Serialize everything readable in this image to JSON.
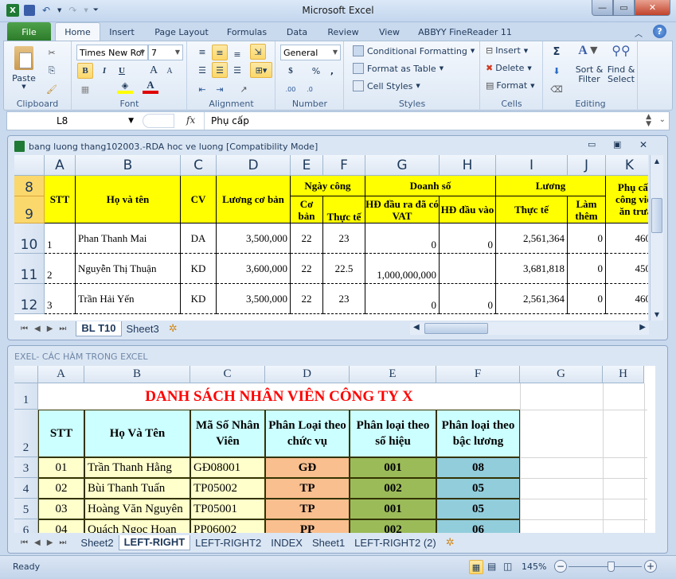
{
  "app": {
    "title": "Microsoft Excel",
    "window_controls": {
      "minimize": "—",
      "maximize": "▭",
      "close": "✕"
    }
  },
  "quick_access": {
    "icons": [
      "excel-logo-icon",
      "save-icon",
      "undo-icon",
      "redo-icon",
      "customize-qat-icon"
    ]
  },
  "ribbon_tabs": [
    "File",
    "Home",
    "Insert",
    "Page Layout",
    "Formulas",
    "Data",
    "Review",
    "View",
    "ABBYY FineReader 11"
  ],
  "active_tab": "Home",
  "ribbon": {
    "clipboard": {
      "label": "Clipboard",
      "paste": "Paste"
    },
    "font": {
      "label": "Font",
      "font_name": "Times New Roi",
      "font_size": "7",
      "bold": "B",
      "italic": "I",
      "underline": "U",
      "grow": "A",
      "shrink": "A",
      "font_color_letter": "A",
      "highlight_color": "#ffff00",
      "font_color": "#e00000"
    },
    "alignment": {
      "label": "Alignment"
    },
    "number": {
      "label": "Number",
      "format": "General",
      "currency": "$",
      "percent": "%",
      "comma": ","
    },
    "styles": {
      "label": "Styles",
      "conditional_formatting": "Conditional Formatting",
      "format_as_table": "Format as Table",
      "cell_styles": "Cell Styles"
    },
    "cells": {
      "label": "Cells",
      "insert": "Insert",
      "delete": "Delete",
      "format": "Format"
    },
    "editing": {
      "label": "Editing",
      "autosum": "Σ",
      "sort_filter_1": "Sort &",
      "sort_filter_2": "Filter",
      "find_select_1": "Find &",
      "find_select_2": "Select"
    }
  },
  "formula_bar": {
    "name_box": "L8",
    "fx": "fx",
    "content": "Phụ cấp"
  },
  "workbook1": {
    "title": "bang luong thang102003.-RDA hoc ve luong  [Compatibility Mode]",
    "columns": [
      "A",
      "B",
      "C",
      "D",
      "E",
      "F",
      "G",
      "H",
      "I",
      "J",
      "K"
    ],
    "rows": [
      "8",
      "9",
      "10",
      "11",
      "12"
    ],
    "headers": {
      "stt": "STT",
      "ho_ten": "Họ và tên",
      "cv": "CV",
      "luong_co_ban": "Lương cơ bản",
      "ngay_cong": "Ngày công",
      "co_ban": "Cơ bản",
      "thuc_te": "Thực tế",
      "doanh_so": "Doanh số",
      "hd_dau_ra": "HĐ đầu ra đã có VAT",
      "hd_dau_vao": "HĐ đầu vào",
      "luong": "Lương",
      "luong_thuc_te": "Thực tế",
      "lam_them": "Làm thêm",
      "phu_cap": "Phụ cấp công việc ăn trưa"
    },
    "data": [
      {
        "stt": "1",
        "name": "Phan Thanh Mai",
        "cv": "DA",
        "base": "3,500,000",
        "co_ban": "22",
        "thuc_te": "23",
        "hd_ra": "0",
        "hd_vao": "0",
        "luong_tt": "2,561,364",
        "lam_them": "0",
        "phu_cap": "460"
      },
      {
        "stt": "2",
        "name": "Nguyễn Thị Thuận",
        "cv": "KD",
        "base": "3,600,000",
        "co_ban": "22",
        "thuc_te": "22.5",
        "hd_ra": "1,000,000,000",
        "hd_vao": "",
        "luong_tt": "3,681,818",
        "lam_them": "0",
        "phu_cap": "450"
      },
      {
        "stt": "3",
        "name": "Trần Hải Yến",
        "cv": "KD",
        "base": "3,500,000",
        "co_ban": "22",
        "thuc_te": "23",
        "hd_ra": "0",
        "hd_vao": "0",
        "luong_tt": "2,561,364",
        "lam_them": "0",
        "phu_cap": "460"
      }
    ],
    "sheet_tabs": [
      "BL T10",
      "Sheet3"
    ],
    "active_sheet": "BL T10"
  },
  "workbook2": {
    "title": "EXEL- CÁC HÀM TRONG EXCEL",
    "columns": [
      "A",
      "B",
      "C",
      "D",
      "E",
      "F",
      "G",
      "H"
    ],
    "rows": [
      "1",
      "2",
      "3",
      "4",
      "5",
      "6"
    ],
    "sheet_title": "DANH SÁCH NHÂN VIÊN CÔNG TY X",
    "headers": [
      "STT",
      "Họ Và Tên",
      "Mã Số Nhân Viên",
      "Phân Loại theo chức vụ",
      "Phân loại theo số hiệu",
      "Phân loại theo bậc lương"
    ],
    "data": [
      [
        "01",
        "Trần Thanh Hằng",
        "GĐ08001",
        "GĐ",
        "001",
        "08"
      ],
      [
        "02",
        "Bùi Thanh Tuấn",
        "TP05002",
        "TP",
        "002",
        "05"
      ],
      [
        "03",
        "Hoàng Văn Nguyên",
        "TP05001",
        "TP",
        "001",
        "05"
      ],
      [
        "04",
        "Quách Ngọc Hoan",
        "PP06002",
        "PP",
        "002",
        "06"
      ]
    ],
    "colors": {
      "title": "#ff0000",
      "header_bg": "#ccffff",
      "body_bg": "#ffffcc",
      "chucvu_bg": "#fabf8f",
      "sohieu_bg": "#9bbb59",
      "bacluong_bg": "#92cddc"
    },
    "sheet_tabs": [
      "Sheet2",
      "LEFT-RIGHT",
      "LEFT-RIGHT2",
      "INDEX",
      "Sheet1",
      "LEFT-RIGHT2 (2)"
    ],
    "active_sheet": "LEFT-RIGHT"
  },
  "status_bar": {
    "status": "Ready",
    "zoom": "145%",
    "zoom_minus": "−",
    "zoom_plus": "+",
    "zoom_level_percent": 145
  }
}
